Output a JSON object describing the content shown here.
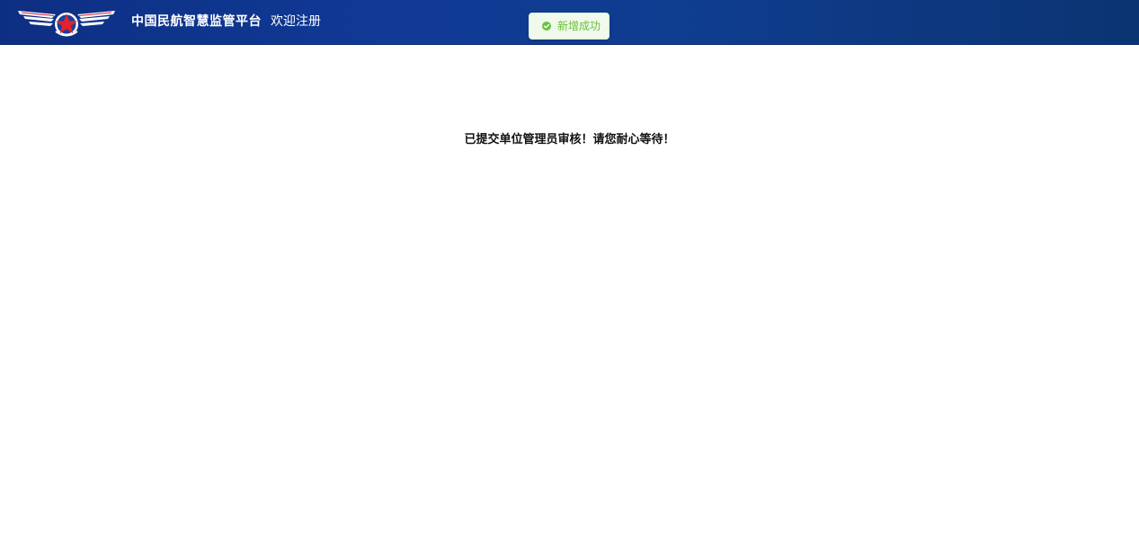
{
  "header": {
    "platform_title": "中国民航智慧监管平台",
    "page_subtitle": "欢迎注册",
    "logo_icon": "caac-wings-star-logo",
    "background_color": "#0f3a92"
  },
  "toast": {
    "type": "success",
    "icon": "check-circle-icon",
    "message": "新增成功",
    "text_color": "#67c23a",
    "background_color": "#f0f9eb"
  },
  "main": {
    "status_message": "已提交单位管理员审核！请您耐心等待！"
  }
}
